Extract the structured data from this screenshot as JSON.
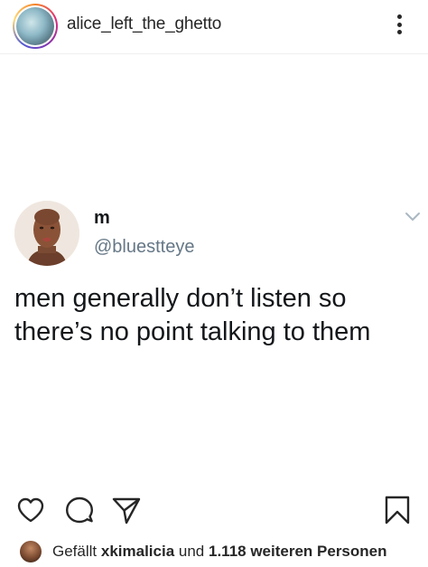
{
  "header": {
    "username": "alice_left_the_ghetto",
    "avatar_icon": "profile-avatar",
    "more_icon": "more-vertical-icon"
  },
  "tweet": {
    "display_name": "m",
    "handle": "@bluestteye",
    "text": "men generally don’t listen so there’s no point talking to them",
    "menu_icon": "chevron-down-icon"
  },
  "actions": {
    "like_icon": "heart-icon",
    "comment_icon": "comment-icon",
    "share_icon": "send-icon",
    "save_icon": "bookmark-icon"
  },
  "likes": {
    "prefix": "Gefällt",
    "user": "xkimalicia",
    "middle": "und",
    "count_text": "1.118 weiteren Personen"
  },
  "colors": {
    "text_primary": "#262626",
    "tweet_text": "#14171a",
    "handle_gray": "#657786",
    "divider": "#efefef"
  }
}
